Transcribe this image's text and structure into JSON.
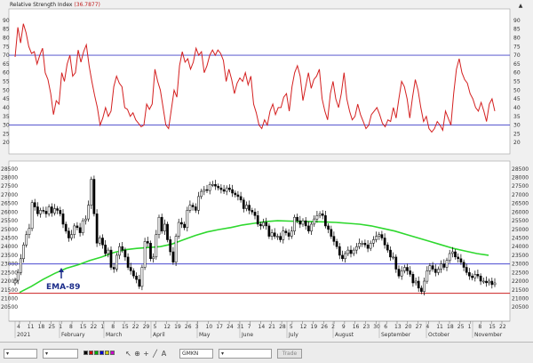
{
  "rsi_panel": {
    "title": "Relative Strength Index",
    "value_text": "(36.7877)"
  },
  "ema_label": "EMA-89",
  "chart_data": [
    {
      "type": "line",
      "title": "Relative Strength Index",
      "ylim": [
        15,
        95
      ],
      "ticks": [
        20,
        25,
        30,
        35,
        40,
        45,
        50,
        55,
        60,
        65,
        70,
        75,
        80,
        85,
        90
      ],
      "reference_lines": [
        30,
        70
      ],
      "series": [
        {
          "name": "Relative Strength Index",
          "color": "#d42020",
          "values": [
            69,
            86,
            77,
            88,
            83,
            75,
            71,
            72,
            65,
            70,
            74,
            60,
            56,
            48,
            36,
            44,
            42,
            60,
            55,
            65,
            70,
            58,
            60,
            73,
            66,
            72,
            76,
            64,
            55,
            47,
            40,
            30,
            34,
            40,
            35,
            38,
            52,
            58,
            54,
            52,
            40,
            39,
            35,
            37,
            33,
            31,
            29,
            30,
            42,
            39,
            42,
            62,
            55,
            50,
            40,
            30,
            28,
            39,
            50,
            46,
            64,
            72,
            66,
            68,
            62,
            66,
            74,
            70,
            72,
            60,
            64,
            70,
            73,
            70,
            73,
            71,
            67,
            55,
            62,
            56,
            48,
            54,
            57,
            55,
            60,
            53,
            58,
            42,
            37,
            30,
            28,
            33,
            30,
            38,
            42,
            36,
            40,
            40,
            46,
            48,
            38,
            52,
            60,
            64,
            58,
            44,
            52,
            60,
            51,
            56,
            58,
            62,
            45,
            38,
            33,
            48,
            55,
            45,
            40,
            48,
            60,
            45,
            38,
            33,
            35,
            42,
            36,
            32,
            28,
            30,
            36,
            38,
            40,
            36,
            31,
            29,
            33,
            32,
            40,
            34,
            45,
            55,
            52,
            45,
            34,
            46,
            56,
            50,
            40,
            32,
            35,
            28,
            26,
            28,
            32,
            30,
            27,
            38,
            34,
            30,
            48,
            62,
            68,
            60,
            56,
            54,
            48,
            45,
            40,
            38,
            43,
            38,
            32,
            42,
            45,
            38
          ]
        }
      ]
    },
    {
      "type": "candlestick",
      "ylim": [
        20200,
        28800
      ],
      "ticks": [
        20500,
        21000,
        21500,
        22000,
        22500,
        23000,
        23500,
        24000,
        24500,
        25000,
        25500,
        26000,
        26500,
        27000,
        27500,
        28000,
        28500
      ],
      "reference_lines": [
        {
          "value": 23000,
          "color": "#4a4ad0"
        },
        {
          "value": 21300,
          "color": "#cc2020"
        }
      ],
      "x_labels": [
        "4",
        "11",
        "18",
        "25",
        "1",
        "8",
        "15",
        "22",
        "1",
        "8",
        "15",
        "22",
        "29",
        "5",
        "12",
        "19",
        "26",
        "3",
        "10",
        "17",
        "24",
        "31",
        "7",
        "14",
        "21",
        "28",
        "5",
        "12",
        "19",
        "26",
        "2",
        "9",
        "16",
        "23",
        "30",
        "6",
        "13",
        "20",
        "27",
        "4",
        "11",
        "18",
        "25",
        "1",
        "8",
        "15",
        "22"
      ],
      "month_labels": [
        "2021",
        "February",
        "March",
        "April",
        "May",
        "June",
        "July",
        "August",
        "September",
        "October",
        "November"
      ],
      "close": [
        22050,
        22500,
        23300,
        24100,
        24700,
        25050,
        26550,
        26300,
        25900,
        26100,
        26050,
        25900,
        26300,
        25950,
        26200,
        26100,
        25900,
        25300,
        24900,
        24500,
        24700,
        25200,
        25100,
        24800,
        25500,
        25600,
        26400,
        27900,
        25900,
        24200,
        24500,
        24100,
        23600,
        23800,
        22800,
        22700,
        23500,
        24000,
        23800,
        23400,
        22800,
        22600,
        22300,
        22100,
        21700,
        22800,
        24300,
        24200,
        23300,
        23400,
        24700,
        25700,
        24900,
        25300,
        24400,
        23700,
        23100,
        24600,
        25400,
        25300,
        25100,
        26100,
        26400,
        26300,
        26100,
        26900,
        27200,
        27300,
        27250,
        27600,
        27600,
        27500,
        27400,
        27300,
        27200,
        27400,
        27300,
        27100,
        27000,
        26900,
        26700,
        26200,
        26400,
        26100,
        26000,
        25800,
        25300,
        25200,
        25400,
        25200,
        24600,
        24800,
        24600,
        24600,
        24400,
        24900,
        24800,
        24600,
        24900,
        25700,
        25500,
        25300,
        25500,
        25200,
        24900,
        25300,
        25600,
        25800,
        25900,
        25800,
        25200,
        25000,
        24600,
        24300,
        24000,
        23500,
        23300,
        23600,
        23800,
        23600,
        23800,
        24000,
        24200,
        24200,
        24100,
        23900,
        24200,
        24400,
        24600,
        24700,
        24500,
        24100,
        23800,
        23400,
        23400,
        22700,
        22300,
        22600,
        22800,
        22600,
        22400,
        21900,
        22000,
        21600,
        21400,
        22000,
        22600,
        22900,
        22700,
        22500,
        22700,
        23000,
        22800,
        23200,
        23600,
        23700,
        23400,
        23300,
        23100,
        22800,
        22500,
        22300,
        22200,
        22400,
        22300,
        22000,
        22000,
        21900,
        22000,
        21800,
        21900
      ],
      "open": [
        21900,
        22050,
        22500,
        23300,
        24100,
        24700,
        25050,
        26550,
        26300,
        25900,
        26100,
        26050,
        25900,
        26300,
        25950,
        26200,
        26100,
        25900,
        25300,
        24900,
        24500,
        24700,
        25200,
        25100,
        24800,
        25500,
        25600,
        26400,
        27900,
        25900,
        24200,
        24500,
        24100,
        23600,
        23800,
        22800,
        22700,
        23500,
        24000,
        23800,
        23400,
        22800,
        22600,
        22300,
        22100,
        21700,
        22800,
        24300,
        24200,
        23300,
        23400,
        24700,
        25700,
        24900,
        25300,
        24400,
        23700,
        23100,
        24600,
        25400,
        25300,
        25100,
        26100,
        26400,
        26300,
        26100,
        26900,
        27200,
        27300,
        27250,
        27600,
        27600,
        27500,
        27400,
        27300,
        27200,
        27400,
        27300,
        27100,
        27000,
        26900,
        26700,
        26200,
        26400,
        26100,
        26000,
        25800,
        25300,
        25200,
        25400,
        25200,
        24600,
        24800,
        24600,
        24600,
        24400,
        24900,
        24800,
        24600,
        24900,
        25700,
        25500,
        25300,
        25500,
        25200,
        24900,
        25300,
        25600,
        25800,
        25900,
        25800,
        25200,
        25000,
        24600,
        24300,
        24000,
        23500,
        23300,
        23600,
        23800,
        23600,
        23800,
        24000,
        24200,
        24200,
        24100,
        23900,
        24200,
        24400,
        24600,
        24700,
        24500,
        24100,
        23800,
        23400,
        23400,
        22700,
        22300,
        22600,
        22800,
        22600,
        22400,
        21900,
        22000,
        21600,
        21400,
        22000,
        22600,
        22900,
        22700,
        22500,
        22700,
        23000,
        22800,
        23200,
        23600,
        23700,
        23400,
        23300,
        23100,
        22800,
        22500,
        22300,
        22200,
        22400,
        22300,
        22000,
        22000,
        21900,
        22000,
        21800
      ],
      "series": [
        {
          "name": "EMA-89",
          "color": "#2ed82e",
          "values": [
            21350,
            21700,
            22100,
            22450,
            22750,
            22950,
            23200,
            23400,
            23650,
            23820,
            23900,
            23950,
            24000,
            24150,
            24400,
            24650,
            24850,
            24990,
            25100,
            25250,
            25350,
            25450,
            25500,
            25480,
            25460,
            25450,
            25430,
            25400,
            25350,
            25300,
            25200,
            25050,
            24900,
            24700,
            24500,
            24300,
            24100,
            23900,
            23750,
            23600,
            23500
          ]
        }
      ]
    }
  ],
  "toolbar": {
    "symbol": "GMKN",
    "button_label": "Trade"
  }
}
